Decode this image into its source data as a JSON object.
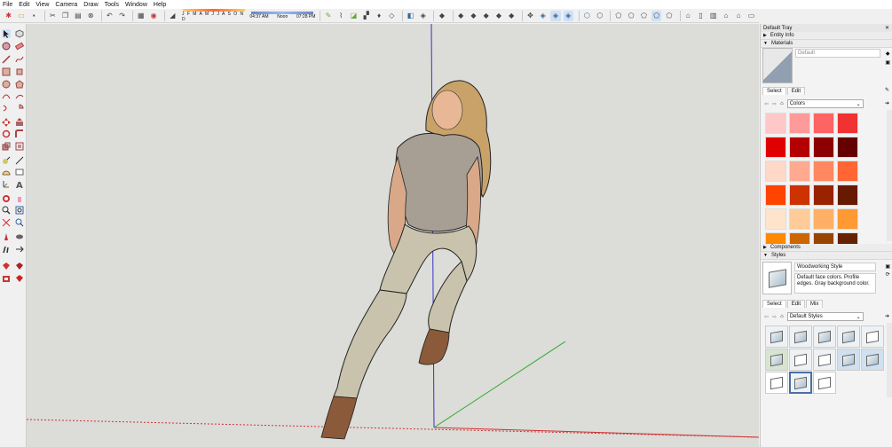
{
  "menu": [
    "File",
    "Edit",
    "View",
    "Camera",
    "Draw",
    "Tools",
    "Window",
    "Help"
  ],
  "toolbar": {
    "months": "J F M A M J J A S O N D",
    "time_start": "04:37 AM",
    "time_mid": "Noon",
    "time_end": "07:28 PM"
  },
  "tray": {
    "title": "Default Tray",
    "entity_info": "Entity Info",
    "materials": {
      "header": "Materials",
      "name": "Default",
      "tab_select": "Select",
      "tab_edit": "Edit",
      "library": "Colors",
      "swatches": [
        "#ffc8c8",
        "#ff9a9a",
        "#ff6464",
        "#f03232",
        "#e00000",
        "#b40000",
        "#8c0000",
        "#640000",
        "#ffd8c8",
        "#ffaa90",
        "#ff8860",
        "#ff6633",
        "#ff4400",
        "#cc3300",
        "#992200",
        "#661a00",
        "#ffe4cc",
        "#ffcc99",
        "#ffb066",
        "#ff9933",
        "#ff8800",
        "#cc6600",
        "#994400",
        "#662200"
      ]
    },
    "components": "Components",
    "styles": {
      "header": "Styles",
      "name": "Woodworking Style",
      "description": "Default face colors. Profile edges. Gray background color.",
      "tab_select": "Select",
      "tab_edit": "Edit",
      "tab_mix": "Mix",
      "library": "Default Styles"
    }
  },
  "colors": {
    "viewport_bg": "#dcdcd8",
    "axis_blue": "#3333cc",
    "axis_red": "#cc3333",
    "axis_green": "#33aa33"
  }
}
